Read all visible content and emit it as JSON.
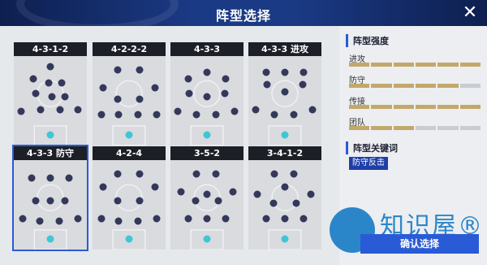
{
  "window": {
    "title": "阵型选择",
    "close_label": "✕"
  },
  "formations": [
    {
      "name": "4-3-1-2",
      "selected": false,
      "players": [
        [
          0.5,
          0.12
        ],
        [
          0.27,
          0.25
        ],
        [
          0.48,
          0.3
        ],
        [
          0.66,
          0.3
        ],
        [
          0.3,
          0.42
        ],
        [
          0.52,
          0.45
        ],
        [
          0.7,
          0.45
        ],
        [
          0.1,
          0.62
        ],
        [
          0.37,
          0.6
        ],
        [
          0.63,
          0.6
        ],
        [
          0.88,
          0.6
        ]
      ]
    },
    {
      "name": "4-2-2-2",
      "selected": false,
      "players": [
        [
          0.34,
          0.15
        ],
        [
          0.64,
          0.15
        ],
        [
          0.14,
          0.35
        ],
        [
          0.86,
          0.35
        ],
        [
          0.34,
          0.48
        ],
        [
          0.64,
          0.48
        ],
        [
          0.12,
          0.65
        ],
        [
          0.36,
          0.65
        ],
        [
          0.62,
          0.65
        ],
        [
          0.88,
          0.65
        ]
      ]
    },
    {
      "name": "4-3-3",
      "selected": false,
      "players": [
        [
          0.24,
          0.25
        ],
        [
          0.5,
          0.18
        ],
        [
          0.76,
          0.25
        ],
        [
          0.26,
          0.42
        ],
        [
          0.5,
          0.45
        ],
        [
          0.74,
          0.42
        ],
        [
          0.1,
          0.62
        ],
        [
          0.36,
          0.65
        ],
        [
          0.62,
          0.65
        ],
        [
          0.88,
          0.62
        ]
      ]
    },
    {
      "name": "4-3-3 进攻",
      "selected": false,
      "players": [
        [
          0.24,
          0.18
        ],
        [
          0.5,
          0.18
        ],
        [
          0.76,
          0.18
        ],
        [
          0.26,
          0.32
        ],
        [
          0.5,
          0.4
        ],
        [
          0.74,
          0.32
        ],
        [
          0.1,
          0.6
        ],
        [
          0.36,
          0.65
        ],
        [
          0.62,
          0.65
        ],
        [
          0.88,
          0.6
        ]
      ]
    },
    {
      "name": "4-3-3 防守",
      "selected": true,
      "players": [
        [
          0.24,
          0.2
        ],
        [
          0.5,
          0.2
        ],
        [
          0.76,
          0.2
        ],
        [
          0.3,
          0.45
        ],
        [
          0.5,
          0.45
        ],
        [
          0.7,
          0.45
        ],
        [
          0.12,
          0.65
        ],
        [
          0.36,
          0.68
        ],
        [
          0.62,
          0.68
        ],
        [
          0.88,
          0.65
        ]
      ]
    },
    {
      "name": "4-2-4",
      "selected": false,
      "players": [
        [
          0.34,
          0.15
        ],
        [
          0.64,
          0.15
        ],
        [
          0.14,
          0.3
        ],
        [
          0.86,
          0.3
        ],
        [
          0.34,
          0.45
        ],
        [
          0.64,
          0.45
        ],
        [
          0.12,
          0.65
        ],
        [
          0.36,
          0.68
        ],
        [
          0.62,
          0.68
        ],
        [
          0.88,
          0.65
        ]
      ]
    },
    {
      "name": "3-5-2",
      "selected": false,
      "players": [
        [
          0.36,
          0.15
        ],
        [
          0.62,
          0.15
        ],
        [
          0.14,
          0.35
        ],
        [
          0.86,
          0.35
        ],
        [
          0.34,
          0.45
        ],
        [
          0.5,
          0.38
        ],
        [
          0.66,
          0.45
        ],
        [
          0.24,
          0.65
        ],
        [
          0.5,
          0.65
        ],
        [
          0.76,
          0.65
        ]
      ]
    },
    {
      "name": "3-4-1-2",
      "selected": false,
      "players": [
        [
          0.36,
          0.15
        ],
        [
          0.62,
          0.15
        ],
        [
          0.5,
          0.3
        ],
        [
          0.12,
          0.38
        ],
        [
          0.86,
          0.38
        ],
        [
          0.34,
          0.48
        ],
        [
          0.66,
          0.48
        ],
        [
          0.24,
          0.65
        ],
        [
          0.5,
          0.65
        ],
        [
          0.76,
          0.65
        ]
      ]
    }
  ],
  "strength": {
    "header": "阵型强度",
    "stats": [
      {
        "label": "进攻",
        "filled": 6,
        "total": 6
      },
      {
        "label": "防守",
        "filled": 5,
        "total": 6
      },
      {
        "label": "传接",
        "filled": 6,
        "total": 6
      },
      {
        "label": "团队",
        "filled": 3,
        "total": 6
      }
    ]
  },
  "keywords": {
    "header": "阵型关键词",
    "tags": [
      "防守反击"
    ]
  },
  "confirm_label": "确认选择",
  "watermark": {
    "text": "知识屋®",
    "url": "zhishiwu.com"
  },
  "colors": {
    "accent": "#2a5bd6",
    "gold": "#c2a86a",
    "gk": "#3fc6d6",
    "player": "#34385a"
  }
}
